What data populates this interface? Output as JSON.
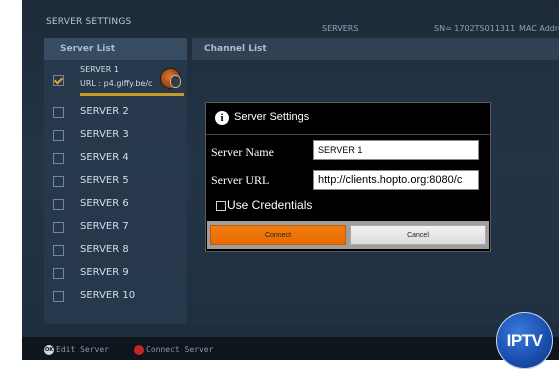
{
  "header": {
    "title": "SERVER SETTINGS",
    "servers_label": "SERVERS",
    "serial": "SN= 1702TS011311",
    "mac": "MAC Addre"
  },
  "server_list": {
    "heading": "Server List",
    "selected": {
      "name": "SERVER 1",
      "url": "URL : p4.giffy.be/c",
      "checked": true
    },
    "items": [
      "SERVER 2",
      "SERVER 3",
      "SERVER 4",
      "SERVER 5",
      "SERVER 6",
      "SERVER 7",
      "SERVER 8",
      "SERVER 9",
      "SERVER 10"
    ]
  },
  "channel_list": {
    "heading": "Channel List"
  },
  "dialog": {
    "title": "Server Settings",
    "name_label": "Server Name",
    "name_value": "SERVER 1",
    "url_label": "Server URL",
    "url_value": "http://clients.hopto.org:8080/c",
    "credentials_label": "Use Credentials",
    "credentials_checked": false,
    "connect_label": "Connect",
    "cancel_label": "Cancel"
  },
  "footer": {
    "ok_icon_text": "OK",
    "ok_action": "Edit Server",
    "red_action": "Connect Server"
  },
  "logo": {
    "text": "IPTV"
  },
  "colors": {
    "accent_orange": "#e86a00",
    "progress_gold": "#c79a2a",
    "red_key": "#c3252a",
    "logo_blue": "#1a4fb0"
  }
}
